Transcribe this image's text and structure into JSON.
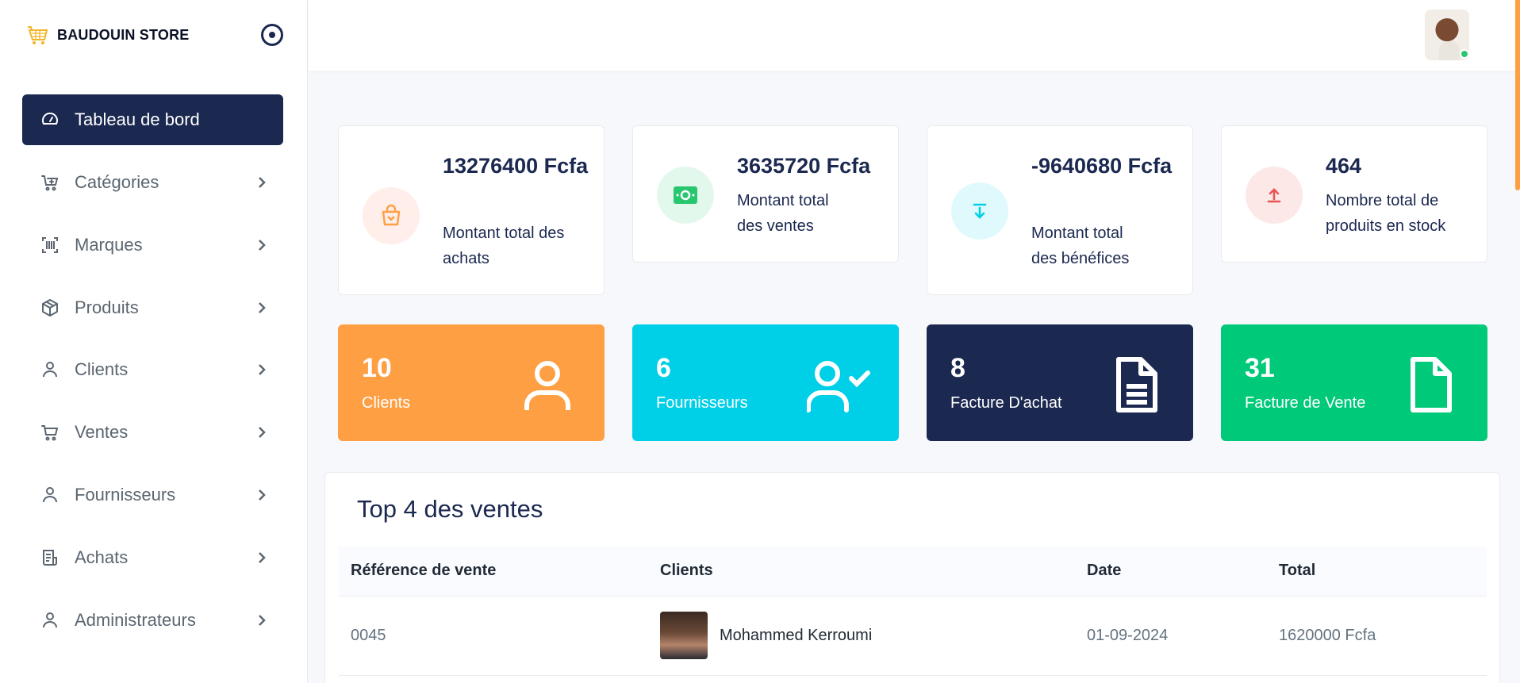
{
  "brand": {
    "name": "BAUDOUIN STORE",
    "logo_icon": "shopping-basket-icon"
  },
  "sidebar": {
    "items": [
      {
        "label": "Tableau de bord",
        "icon": "dashboard-gauge-icon",
        "active": true
      },
      {
        "label": "Catégories",
        "icon": "cart-plus-icon"
      },
      {
        "label": "Marques",
        "icon": "barcode-icon"
      },
      {
        "label": "Produits",
        "icon": "box-icon"
      },
      {
        "label": "Clients",
        "icon": "user-icon"
      },
      {
        "label": "Ventes",
        "icon": "shopping-cart-icon"
      },
      {
        "label": "Fournisseurs",
        "icon": "user-icon"
      },
      {
        "label": "Achats",
        "icon": "receipt-icon"
      },
      {
        "label": "Administrateurs",
        "icon": "user-icon"
      }
    ]
  },
  "stats": [
    {
      "value": "13276400 Fcfa",
      "desc": "Montant total des achats",
      "icon": "shopping-bag-icon",
      "color": "#ff9f43",
      "bg": "#ffeee9"
    },
    {
      "value": "3635720 Fcfa",
      "desc": "Montant total des ventes",
      "icon": "money-bill-icon",
      "color": "#28c76f",
      "bg": "#e3f8ec"
    },
    {
      "value": "-9640680 Fcfa",
      "desc": "Montant total des bénéfices",
      "icon": "download-icon",
      "color": "#00cfe8",
      "bg": "#e0f9fc"
    },
    {
      "value": "464",
      "desc": "Nombre total de produits en stock",
      "icon": "upload-icon",
      "color": "#ea5455",
      "bg": "#fde8e8"
    }
  ],
  "counters": [
    {
      "count": "10",
      "label": "Clients",
      "icon": "user-icon",
      "color": "#ff9f43"
    },
    {
      "count": "6",
      "label": "Fournisseurs",
      "icon": "user-check-icon",
      "color": "#00cfe8"
    },
    {
      "count": "8",
      "label": "Facture D'achat",
      "icon": "file-text-icon",
      "color": "#1b2850"
    },
    {
      "count": "31",
      "label": "Facture de Vente",
      "icon": "file-icon",
      "color": "#00c97a"
    }
  ],
  "top_sales": {
    "title": "Top 4 des ventes",
    "columns": [
      "Référence de vente",
      "Clients",
      "Date",
      "Total"
    ],
    "rows": [
      {
        "ref": "0045",
        "client": "Mohammed Kerroumi",
        "date": "01-09-2024",
        "total": "1620000 Fcfa"
      }
    ]
  }
}
